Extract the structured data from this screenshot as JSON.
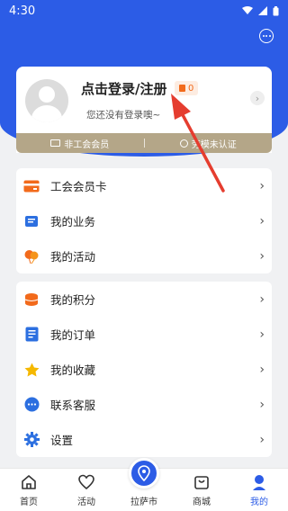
{
  "status_bar": {
    "time": "4:30"
  },
  "profile": {
    "login_title": "点击登录/注册",
    "coin_count": "0",
    "subtitle": "您还没有登录噢~"
  },
  "member_bar": {
    "left_label": "非工会会员",
    "right_label": "劳模未认证"
  },
  "menu_groups": [
    {
      "items": [
        {
          "label": "工会会员卡",
          "icon": "member-card-icon",
          "color": "#f26a1b"
        },
        {
          "label": "我的业务",
          "icon": "business-icon",
          "color": "#2c6fe0"
        },
        {
          "label": "我的活动",
          "icon": "balloons-icon",
          "color": "#f26a1b"
        }
      ]
    },
    {
      "items": [
        {
          "label": "我的积分",
          "icon": "points-icon",
          "color": "#f26a1b"
        },
        {
          "label": "我的订单",
          "icon": "order-icon",
          "color": "#2c6fe0"
        },
        {
          "label": "我的收藏",
          "icon": "star-icon",
          "color": "#f5b800"
        },
        {
          "label": "联系客服",
          "icon": "chat-icon",
          "color": "#2c6fe0"
        },
        {
          "label": "设置",
          "icon": "gear-icon",
          "color": "#2c6fe0"
        }
      ]
    }
  ],
  "tabs": [
    {
      "label": "首页",
      "icon": "home-icon"
    },
    {
      "label": "活动",
      "icon": "heart-icon"
    },
    {
      "label": "拉萨市",
      "icon": "location-icon"
    },
    {
      "label": "商城",
      "icon": "shopping-bag-icon"
    },
    {
      "label": "我的",
      "icon": "user-icon",
      "active": true
    }
  ],
  "colors": {
    "brand_blue": "#2c5ce6",
    "member_gold": "#b4a688",
    "accent_orange": "#f26a1b",
    "annotation_red": "#e53d2f"
  }
}
